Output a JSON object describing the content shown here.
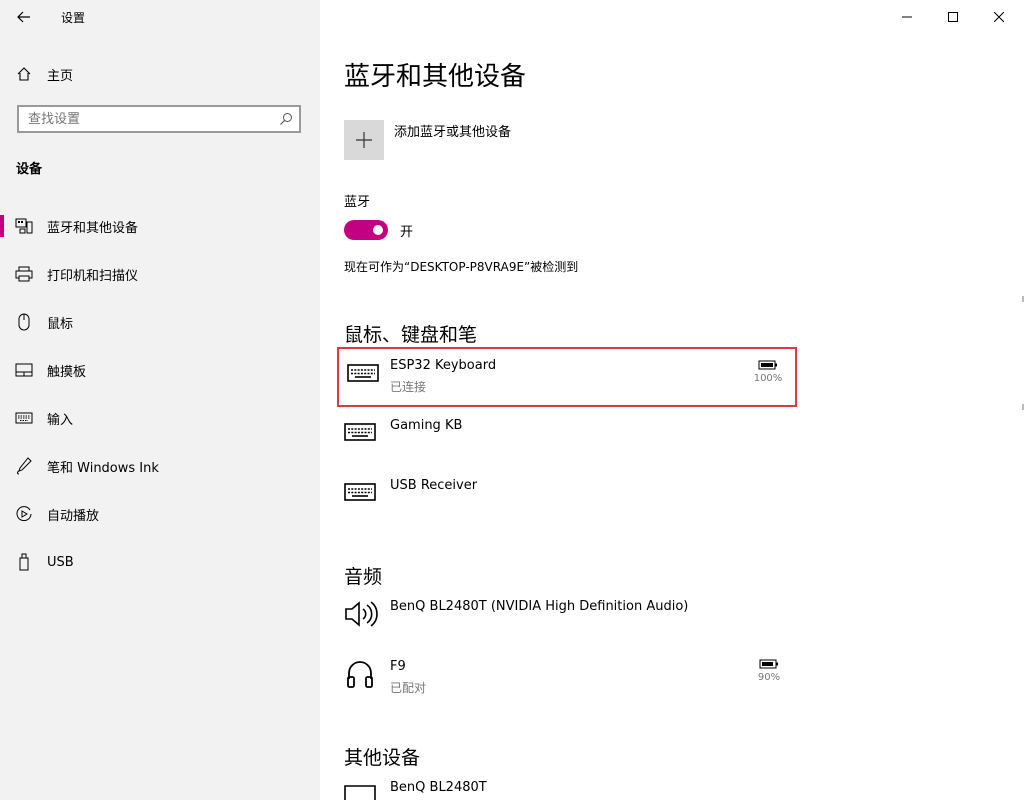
{
  "window": {
    "title": "设置",
    "controls": {
      "minimize": "minimize-icon",
      "maximize": "maximize-icon",
      "close": "close-icon"
    }
  },
  "sidebar": {
    "home_label": "主页",
    "search_placeholder": "查找设置",
    "section_title": "设备",
    "items": [
      {
        "label": "蓝牙和其他设备",
        "icon": "bluetooth-devices-icon",
        "selected": true
      },
      {
        "label": "打印机和扫描仪",
        "icon": "printer-icon"
      },
      {
        "label": "鼠标",
        "icon": "mouse-icon"
      },
      {
        "label": "触摸板",
        "icon": "touchpad-icon"
      },
      {
        "label": "输入",
        "icon": "keyboard-icon"
      },
      {
        "label": "笔和 Windows Ink",
        "icon": "pen-icon"
      },
      {
        "label": "自动播放",
        "icon": "autoplay-icon"
      },
      {
        "label": "USB",
        "icon": "usb-icon"
      }
    ]
  },
  "main": {
    "title": "蓝牙和其他设备",
    "add_device_label": "添加蓝牙或其他设备",
    "bluetooth": {
      "label": "蓝牙",
      "toggle_state": "开",
      "discoverable_text": "现在可作为“DESKTOP-P8VRA9E”被检测到"
    },
    "input_section": {
      "title": "鼠标、键盘和笔",
      "devices": [
        {
          "name": "ESP32 Keyboard",
          "status": "已连接",
          "battery": "100%",
          "icon": "keyboard-icon",
          "highlighted": true
        },
        {
          "name": "Gaming KB",
          "status": "",
          "icon": "keyboard-icon"
        },
        {
          "name": "USB Receiver",
          "status": "",
          "icon": "keyboard-icon"
        }
      ]
    },
    "audio_section": {
      "title": "音频",
      "devices": [
        {
          "name": "BenQ BL2480T (NVIDIA High Definition Audio)",
          "status": "",
          "icon": "speaker-icon"
        },
        {
          "name": "F9",
          "status": "已配对",
          "battery": "90%",
          "icon": "headphones-icon"
        }
      ]
    },
    "other_section": {
      "title": "其他设备",
      "devices": [
        {
          "name": "BenQ BL2480T",
          "status": "",
          "icon": "monitor-icon"
        }
      ]
    }
  },
  "colors": {
    "accent": "#c30081",
    "highlight_border": "#e0393e",
    "sidebar_bg": "#f2f2f2",
    "muted_text": "#767676"
  }
}
